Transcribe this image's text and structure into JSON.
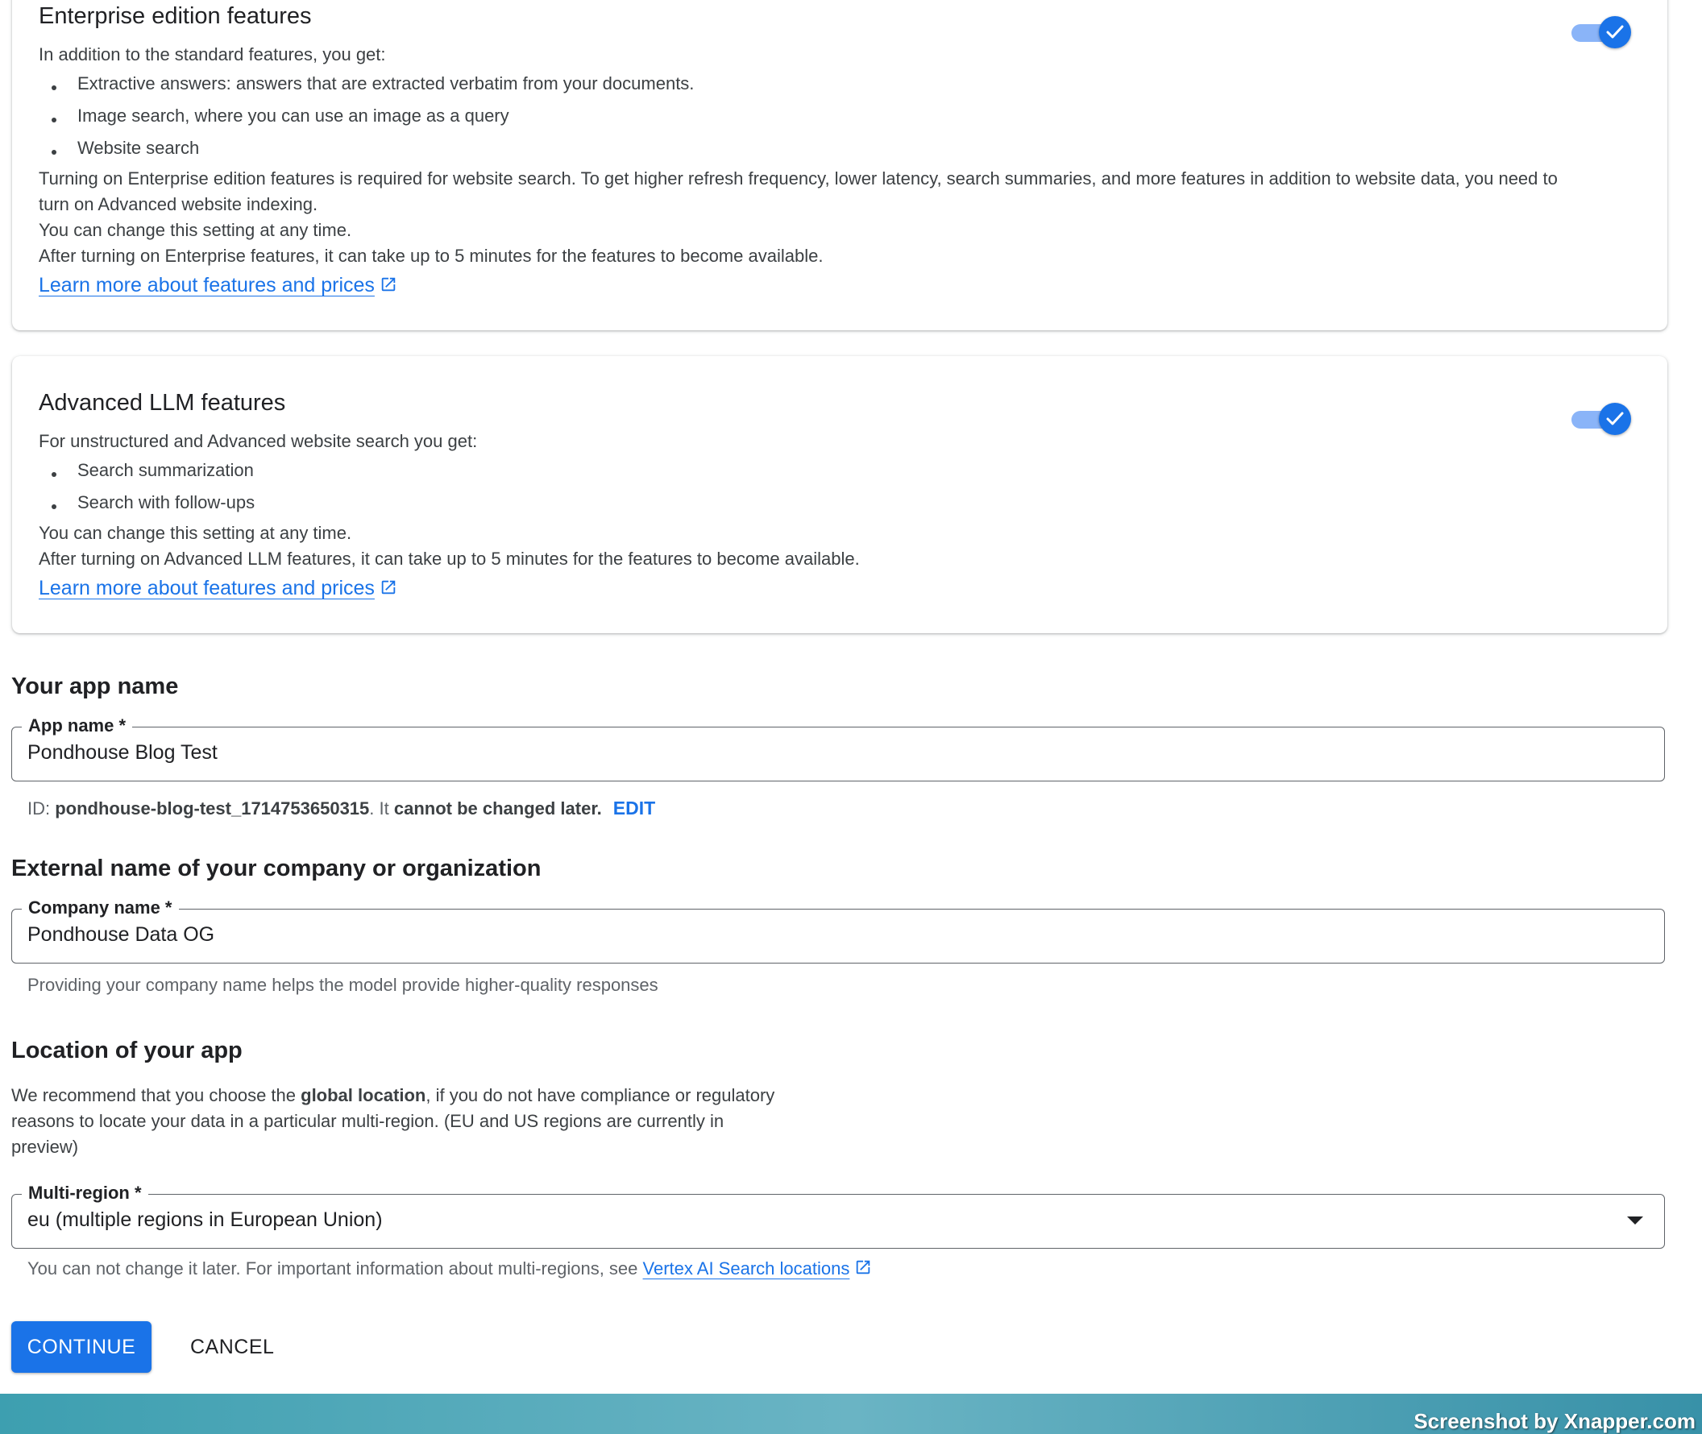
{
  "enterprise": {
    "title": "Enterprise edition features",
    "intro": "In addition to the standard features, you get:",
    "bullets": [
      "Extractive answers: answers that are extracted verbatim from your documents.",
      "Image search, where you can use an image as a query",
      "Website search"
    ],
    "para1": "Turning on Enterprise edition features is required for website search. To get higher refresh frequency, lower latency, search summaries, and more features in addition to website data, you need to turn on Advanced website indexing.",
    "para2": "You can change this setting at any time.",
    "para3": "After turning on Enterprise features, it can take up to 5 minutes for the features to become available.",
    "link": "Learn more about features and prices",
    "toggle_on": true
  },
  "llm": {
    "title": "Advanced LLM features",
    "intro": "For unstructured and Advanced website search you get:",
    "bullets": [
      "Search summarization",
      "Search with follow-ups"
    ],
    "para1": "You can change this setting at any time.",
    "para2": "After turning on Advanced LLM features, it can take up to 5 minutes for the features to become available.",
    "link": "Learn more about features and prices",
    "toggle_on": true
  },
  "app_name": {
    "heading": "Your app name",
    "label": "App name *",
    "value": "Pondhouse Blog Test",
    "id_prefix": "ID: ",
    "id_value": "pondhouse-blog-test_1714753650315",
    "id_mid": ". It ",
    "id_bold": "cannot be changed later.",
    "edit": "EDIT"
  },
  "company": {
    "heading": "External name of your company or organization",
    "label": "Company name *",
    "value": "Pondhouse Data OG",
    "hint": "Providing your company name helps the model provide higher-quality responses"
  },
  "location": {
    "heading": "Location of your app",
    "desc_pre": "We recommend that you choose the ",
    "desc_bold": "global location",
    "desc_line1_post": ", if you do not have compliance or regulatory",
    "desc_line2": "reasons to locate your data in a particular multi-region. (EU and US regions are currently in",
    "desc_line3": "preview)",
    "label": "Multi-region *",
    "value": "eu (multiple regions in European Union)",
    "hint": "You can not change it later. For important information about multi-regions, see ",
    "hint_link": "Vertex AI Search locations"
  },
  "actions": {
    "continue": "CONTINUE",
    "cancel": "CANCEL"
  },
  "watermark": "Screenshot by Xnapper.com",
  "colors": {
    "primary": "#1a73e8",
    "toggle_track": "#8ab4f8"
  }
}
